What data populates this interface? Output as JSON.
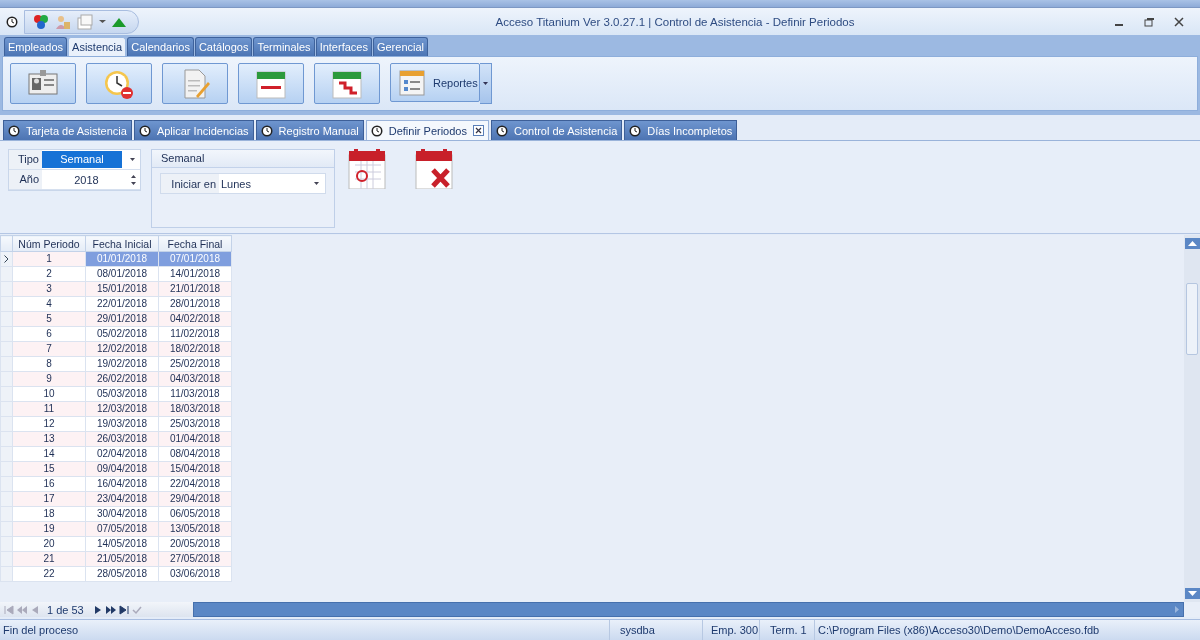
{
  "window": {
    "title": "Acceso Titanium  Ver 3.0.27.1 | Control de Asistencia - Definir Periodos"
  },
  "ribbon_tabs": [
    {
      "label": "Empleados",
      "selected": false
    },
    {
      "label": "Asistencia",
      "selected": true
    },
    {
      "label": "Calendarios",
      "selected": false
    },
    {
      "label": "Catálogos",
      "selected": false
    },
    {
      "label": "Terminales",
      "selected": false
    },
    {
      "label": "Interfaces",
      "selected": false
    },
    {
      "label": "Gerencial",
      "selected": false
    }
  ],
  "ribbon_buttons": [
    {
      "kind": "plain"
    },
    {
      "kind": "plain"
    },
    {
      "kind": "plain"
    },
    {
      "kind": "plain"
    },
    {
      "kind": "plain"
    },
    {
      "kind": "split",
      "label": "Reportes"
    }
  ],
  "doc_tabs": [
    {
      "label": "Tarjeta de Asistencia",
      "selected": false
    },
    {
      "label": "Aplicar Incidencias",
      "selected": false
    },
    {
      "label": "Registro Manual",
      "selected": false
    },
    {
      "label": "Definir Periodos",
      "selected": true
    },
    {
      "label": "Control de Asistencia",
      "selected": false
    },
    {
      "label": "Días Incompletos",
      "selected": false
    }
  ],
  "form": {
    "tipo_label": "Tipo",
    "tipo_value": "Semanal",
    "anio_label": "Año",
    "anio_value": "2018",
    "group_title": "Semanal",
    "iniciar_label": "Iniciar en",
    "iniciar_value": "Lunes"
  },
  "table": {
    "columns": [
      "Núm Periodo",
      "Fecha Inicial",
      "Fecha Final"
    ],
    "rows": [
      {
        "cells": [
          "1",
          "01/01/2018",
          "07/01/2018"
        ],
        "selected": true
      },
      {
        "cells": [
          "2",
          "08/01/2018",
          "14/01/2018"
        ],
        "selected": false
      },
      {
        "cells": [
          "3",
          "15/01/2018",
          "21/01/2018"
        ],
        "selected": false
      },
      {
        "cells": [
          "4",
          "22/01/2018",
          "28/01/2018"
        ],
        "selected": false
      },
      {
        "cells": [
          "5",
          "29/01/2018",
          "04/02/2018"
        ],
        "selected": false
      },
      {
        "cells": [
          "6",
          "05/02/2018",
          "11/02/2018"
        ],
        "selected": false
      },
      {
        "cells": [
          "7",
          "12/02/2018",
          "18/02/2018"
        ],
        "selected": false
      },
      {
        "cells": [
          "8",
          "19/02/2018",
          "25/02/2018"
        ],
        "selected": false
      },
      {
        "cells": [
          "9",
          "26/02/2018",
          "04/03/2018"
        ],
        "selected": false
      },
      {
        "cells": [
          "10",
          "05/03/2018",
          "11/03/2018"
        ],
        "selected": false
      },
      {
        "cells": [
          "11",
          "12/03/2018",
          "18/03/2018"
        ],
        "selected": false
      },
      {
        "cells": [
          "12",
          "19/03/2018",
          "25/03/2018"
        ],
        "selected": false
      },
      {
        "cells": [
          "13",
          "26/03/2018",
          "01/04/2018"
        ],
        "selected": false
      },
      {
        "cells": [
          "14",
          "02/04/2018",
          "08/04/2018"
        ],
        "selected": false
      },
      {
        "cells": [
          "15",
          "09/04/2018",
          "15/04/2018"
        ],
        "selected": false
      },
      {
        "cells": [
          "16",
          "16/04/2018",
          "22/04/2018"
        ],
        "selected": false
      },
      {
        "cells": [
          "17",
          "23/04/2018",
          "29/04/2018"
        ],
        "selected": false
      },
      {
        "cells": [
          "18",
          "30/04/2018",
          "06/05/2018"
        ],
        "selected": false
      },
      {
        "cells": [
          "19",
          "07/05/2018",
          "13/05/2018"
        ],
        "selected": false
      },
      {
        "cells": [
          "20",
          "14/05/2018",
          "20/05/2018"
        ],
        "selected": false
      },
      {
        "cells": [
          "21",
          "21/05/2018",
          "27/05/2018"
        ],
        "selected": false
      },
      {
        "cells": [
          "22",
          "28/05/2018",
          "03/06/2018"
        ],
        "selected": false
      }
    ]
  },
  "navigator": {
    "position": "1 de 53"
  },
  "status_bar": [
    "Fin del proceso",
    "sysdba",
    "Emp. 300",
    "Term. 1",
    "C:\\Program Files (x86)\\Acceso30\\Demo\\DemoAcceso.fdb"
  ]
}
